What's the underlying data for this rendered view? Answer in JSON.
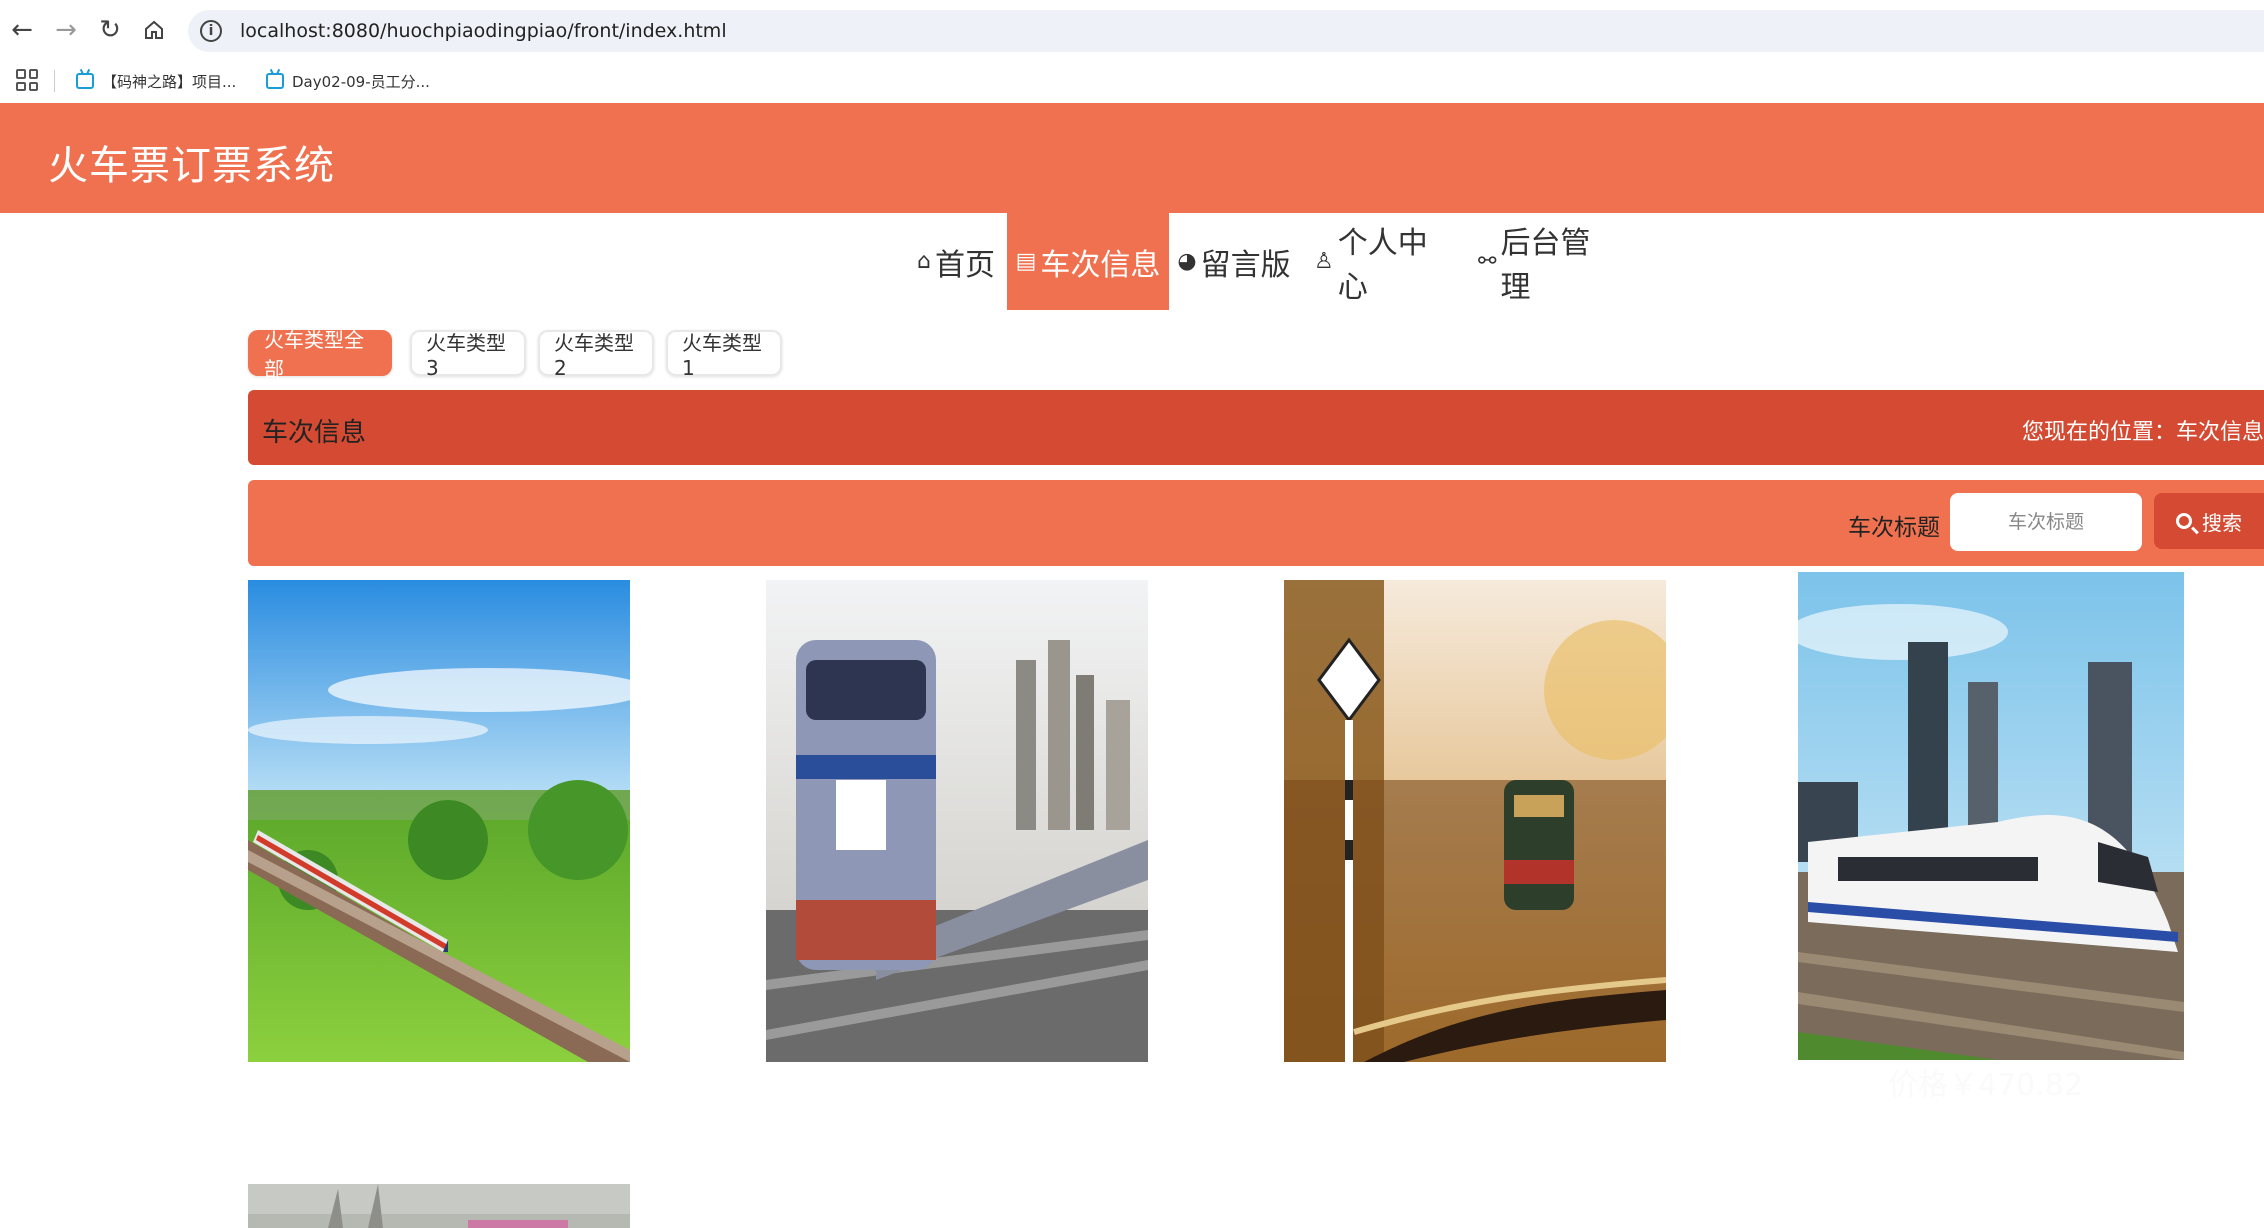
{
  "browser": {
    "url": "localhost:8080/huochpiaodingpiao/front/index.html",
    "bookmarks": [
      {
        "label": "【码神之路】项目..."
      },
      {
        "label": "Day02-09-员工分..."
      }
    ]
  },
  "header": {
    "title": "火车票订票系统"
  },
  "nav": {
    "items": [
      {
        "label": "首页",
        "icon": "home-icon"
      },
      {
        "label": "车次信息",
        "icon": "document-icon"
      },
      {
        "label": "留言版",
        "icon": "palette-icon"
      },
      {
        "label": "个人中心",
        "icon": "user-icon"
      },
      {
        "label": "后台管理",
        "icon": "link-icon"
      }
    ],
    "active": "车次信息"
  },
  "categories": {
    "items": [
      "火车类型全部",
      "火车类型3",
      "火车类型2",
      "火车类型1"
    ],
    "active": "火车类型全部"
  },
  "section": {
    "title": "车次信息",
    "breadcrumb": "您现在的位置：车次信息"
  },
  "search": {
    "label": "车次标题",
    "placeholder": "车次标题",
    "button_label": "搜索"
  },
  "cards": [
    {
      "image": "high-speed-train-countryside"
    },
    {
      "image": "diesel-locomotive-city"
    },
    {
      "image": "locomotive-autumn-forest"
    },
    {
      "image": "white-emu-train-station",
      "price": "价格￥470.82"
    },
    {
      "image": "train-winter-trees"
    }
  ],
  "colors": {
    "primary": "#f0714f",
    "accent": "#d44a32"
  }
}
